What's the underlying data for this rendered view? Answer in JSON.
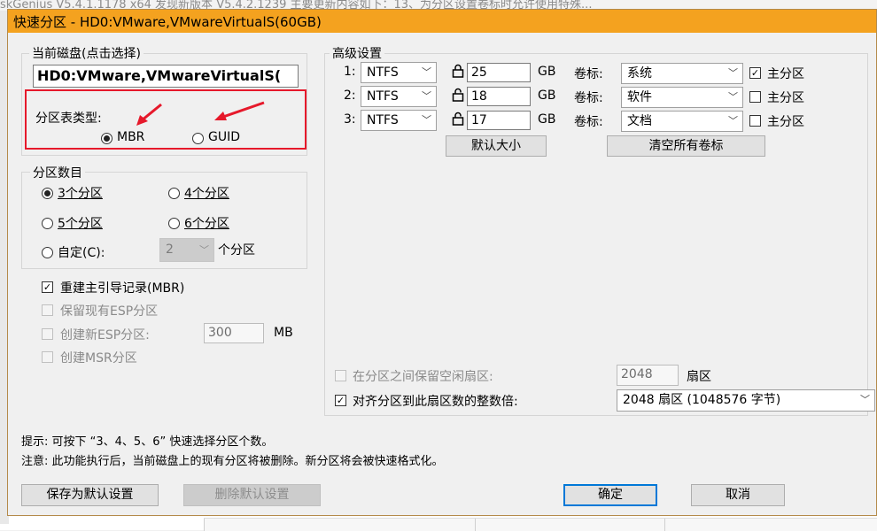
{
  "background": {
    "bar_text": "skGenius V5.4.1.1178 x64    发现新版本 V5.4.2.1239    主要更新内容如下：13、为分区设置卷标时允许使用特殊..."
  },
  "dialog": {
    "title": "快速分区 - HD0:VMware,VMwareVirtualS(60GB)"
  },
  "current_disk": {
    "label": "当前磁盘(点击选择)",
    "value": "HD0:VMware,VMwareVirtualS("
  },
  "partition_table": {
    "label": "分区表类型:",
    "options": [
      "MBR",
      "GUID"
    ],
    "selected": "MBR"
  },
  "partition_count": {
    "label": "分区数目",
    "options": [
      "3个分区",
      "4个分区",
      "5个分区",
      "6个分区"
    ],
    "selected": "3个分区",
    "custom_label": "自定(C):",
    "custom_value": "2",
    "custom_suffix": "个分区"
  },
  "options": {
    "rebuild_mbr": {
      "label": "重建主引导记录(MBR)",
      "checked": true
    },
    "keep_esp": {
      "label": "保留现有ESP分区",
      "checked": false
    },
    "new_esp": {
      "label": "创建新ESP分区:",
      "checked": false,
      "size": "300",
      "unit": "MB"
    },
    "msr": {
      "label": "创建MSR分区",
      "checked": false
    }
  },
  "advanced": {
    "label": "高级设置",
    "gb_label": "GB",
    "volume_label": "卷标:",
    "primary_label": "主分区",
    "rows": [
      {
        "index": "1:",
        "fs": "NTFS",
        "size": "25",
        "volume": "系统",
        "primary": true
      },
      {
        "index": "2:",
        "fs": "NTFS",
        "size": "18",
        "volume": "软件",
        "primary": false
      },
      {
        "index": "3:",
        "fs": "NTFS",
        "size": "17",
        "volume": "文档",
        "primary": false
      }
    ],
    "default_size_button": "默认大小",
    "clear_labels_button": "清空所有卷标",
    "reserve_sectors": {
      "label": "在分区之间保留空闲扇区:",
      "value": "2048",
      "unit": "扇区",
      "checked": false
    },
    "align": {
      "label": "对齐分区到此扇区数的整数倍:",
      "value": "2048 扇区 (1048576 字节)",
      "checked": true
    }
  },
  "hints": {
    "tip": "提示: 可按下 “3、4、5、6” 快速选择分区个数。",
    "warning": "注意: 此功能执行后，当前磁盘上的现有分区将被删除。新分区将会被快速格式化。"
  },
  "buttons": {
    "save_default": "保存为默认设置",
    "delete_default": "删除默认设置",
    "ok": "确定",
    "cancel": "取消"
  },
  "colors": {
    "titlebar": "#f4a21f",
    "annotation_red": "#e6192b",
    "focus_blue": "#0078d7"
  }
}
